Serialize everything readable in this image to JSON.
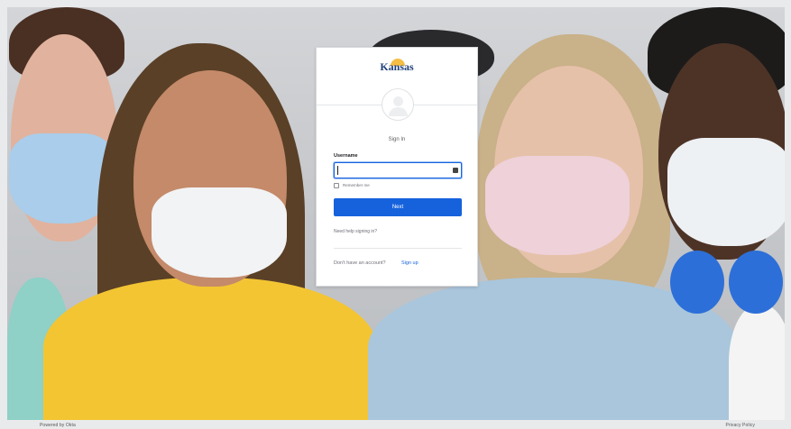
{
  "login": {
    "logo_text": "Kansas",
    "title": "Sign In",
    "username_label": "Username",
    "username_value": "",
    "remember_label": "Remember me",
    "next_label": "Next",
    "help_link": "Need help signing in?",
    "signup_prompt": "Don't have an account?",
    "signup_link": "Sign up"
  },
  "footer": {
    "powered_by": "Powered by Okta",
    "privacy": "Privacy Policy"
  },
  "colors": {
    "primary": "#1662dd",
    "logo": "#1f3f7a",
    "logo_sun": "#f5b323"
  }
}
